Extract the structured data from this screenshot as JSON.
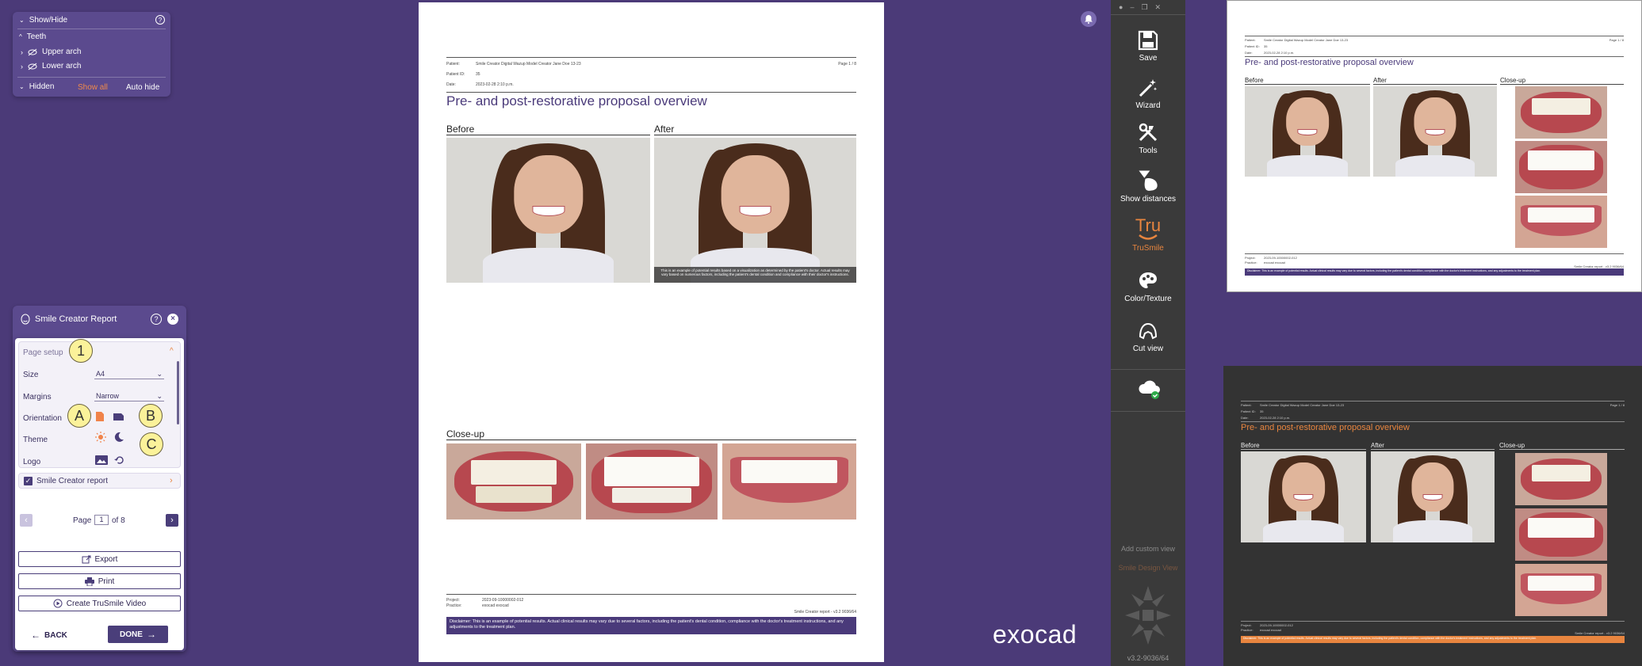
{
  "showhide": {
    "title": "Show/Hide",
    "teeth": "Teeth",
    "upper_arch": "Upper arch",
    "lower_arch": "Lower arch",
    "hidden": "Hidden",
    "show_all": "Show all",
    "auto_hide": "Auto hide"
  },
  "report": {
    "title": "Smile Creator Report",
    "page_setup": "Page setup",
    "size_label": "Size",
    "size_value": "A4",
    "margins_label": "Margins",
    "margins_value": "Narrow",
    "orientation_label": "Orientation",
    "theme_label": "Theme",
    "logo_label": "Logo",
    "section_smile": "Smile Creator report",
    "page_label": "Page",
    "page_value": "1",
    "page_of": "of 8",
    "export": "Export",
    "print": "Print",
    "video": "Create TruSmile Video",
    "back": "BACK",
    "done": "DONE"
  },
  "callouts": {
    "one": "1",
    "a": "A",
    "b": "B",
    "c": "C"
  },
  "document": {
    "patient_label": "Patient:",
    "patient_value": "Smile Creator Digital Wazup Model Creator Jane Doe 13-23",
    "patient_id_label": "Patient ID:",
    "patient_id_value": "35",
    "date_label": "Date:",
    "date_value": "2023-02-28 2:10 p.m.",
    "page": "Page 1 / 8",
    "title": "Pre- and post-restorative proposal overview",
    "before": "Before",
    "after": "After",
    "closeup": "Close-up",
    "after_caption": "This is an example of potential results based on a visualization as determined by the patient's doctor. Actual results may vary based on numerous factors, including the patient's dental condition and compliance with their doctor's instructions.",
    "project_label": "Project:",
    "project_value": "2023-09-10000002-012",
    "practice_label": "Practice:",
    "practice_value": "exocad exocad",
    "footer_right": "Smile Creator report - v3.2 9036/64",
    "disclaimer": "Disclaimer: This is an example of potential results. Actual clinical results may vary due to several factors, including the patient's dental condition, compliance with the doctor's treatment instructions, and any adjustments to the treatment plan."
  },
  "brand": "exocad",
  "toolbar": {
    "save": "Save",
    "wizard": "Wizard",
    "tools": "Tools",
    "show_distances": "Show distances",
    "trusmile": "TruSmile",
    "trusmile_logo": "Tru",
    "color_texture": "Color/Texture",
    "cut_view": "Cut view",
    "add_custom_view": "Add custom view",
    "smile_design_view": "Smile Design View",
    "version": "v3.2-9036/64"
  },
  "colors": {
    "background": "#4b3a78",
    "accent": "#e8853f",
    "toolbar": "#3a3a3a",
    "panel": "#5b4a8e",
    "doc_title": "#4a3a7a"
  },
  "icons": [
    "chevron-down-icon",
    "help-icon",
    "eye-off-icon",
    "face-icon",
    "close-icon",
    "checkbox-icon",
    "export-icon",
    "print-icon",
    "video-icon",
    "arrow-left-icon",
    "arrow-right-icon",
    "save-icon",
    "wizard-icon",
    "tools-icon",
    "distance-icon",
    "trusmile-icon",
    "palette-icon",
    "cut-view-icon",
    "cloud-icon",
    "bell-icon"
  ]
}
